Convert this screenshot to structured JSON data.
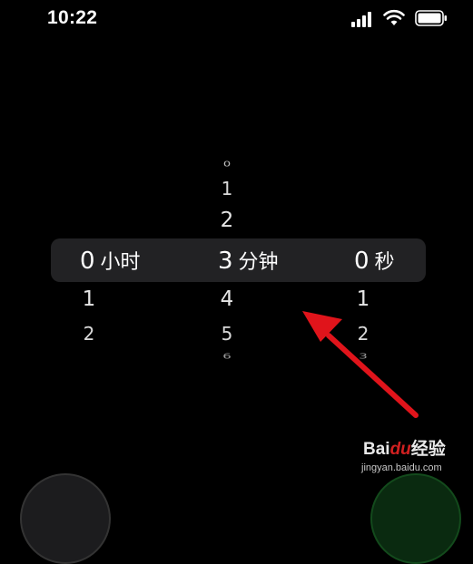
{
  "status_bar": {
    "time": "10:22"
  },
  "timer_picker": {
    "hours": {
      "above": [],
      "value": "0",
      "unit": "小时",
      "below": [
        "1",
        "2"
      ]
    },
    "minutes": {
      "above": [
        "0",
        "1",
        "2"
      ],
      "value": "3",
      "unit": "分钟",
      "below": [
        "4",
        "5",
        "6"
      ]
    },
    "seconds": {
      "above": [],
      "value": "0",
      "unit": "秒",
      "below": [
        "1",
        "2",
        "3"
      ]
    }
  },
  "watermark": {
    "brand_prefix": "Bai",
    "brand_mid": "du",
    "brand_suffix": "经验",
    "url": "jingyan.baidu.com"
  },
  "annotation_color": "#e0141b"
}
